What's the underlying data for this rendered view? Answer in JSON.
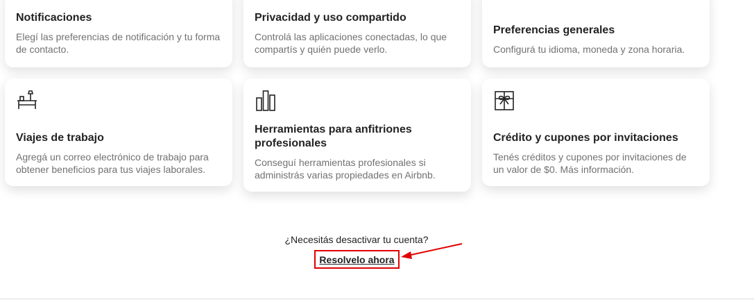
{
  "cards": [
    {
      "title": "Notificaciones",
      "desc": "Elegí las preferencias de notificación y tu forma de contacto.",
      "icon": "bell-icon"
    },
    {
      "title": "Privacidad y uso compartido",
      "desc": "Controlá las aplicaciones conectadas, lo que compartís y quién puede verlo.",
      "icon": "privacy-icon"
    },
    {
      "title": "Preferencias generales",
      "desc": "Configurá tu idioma, moneda y zona horaria.",
      "icon": "toggle-icon"
    },
    {
      "title": "Viajes de trabajo",
      "desc": "Agregá un correo electrónico de trabajo para obtener beneficios para tus viajes laborales.",
      "icon": "desk-lamp-icon"
    },
    {
      "title": "Herramientas para anfitriones profesionales",
      "desc": "Conseguí herramientas profesionales si administrás varias propiedades en Airbnb.",
      "icon": "bar-chart-icon"
    },
    {
      "title": "Crédito y cupones por invitaciones",
      "desc": "Tenés créditos y cupones por invitaciones de un valor de $0. Más información.",
      "icon": "gift-icon"
    }
  ],
  "footer": {
    "question": "¿Necesitás desactivar tu cuenta?",
    "link": "Resolvelo ahora"
  },
  "annotation": {
    "color": "#e00000"
  }
}
